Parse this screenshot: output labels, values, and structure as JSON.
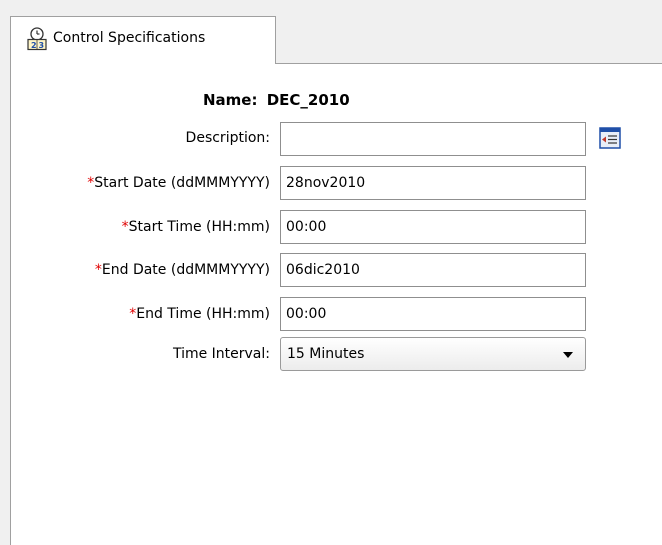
{
  "tab": {
    "label": "Control Specifications",
    "icon": "control-spec-clock-icon"
  },
  "form": {
    "name_label": "Name:",
    "name_value": "DEC_2010",
    "description": {
      "label": "Description:",
      "value": "",
      "button_icon": "editor-icon"
    },
    "start_date": {
      "required_mark": "*",
      "label": "Start Date (ddMMMYYYY)",
      "value": "28nov2010"
    },
    "start_time": {
      "required_mark": "*",
      "label": "Start Time (HH:mm)",
      "value": "00:00"
    },
    "end_date": {
      "required_mark": "*",
      "label": "End Date (ddMMMYYYY)",
      "value": "06dic2010"
    },
    "end_time": {
      "required_mark": "*",
      "label": "End Time (HH:mm)",
      "value": "00:00"
    },
    "time_interval": {
      "label": "Time Interval:",
      "value": "15 Minutes"
    }
  },
  "colors": {
    "required": "#e00000",
    "panel_bg": "#ffffff",
    "window_bg": "#f0f0f0",
    "icon_blue": "#1f4fa8"
  }
}
